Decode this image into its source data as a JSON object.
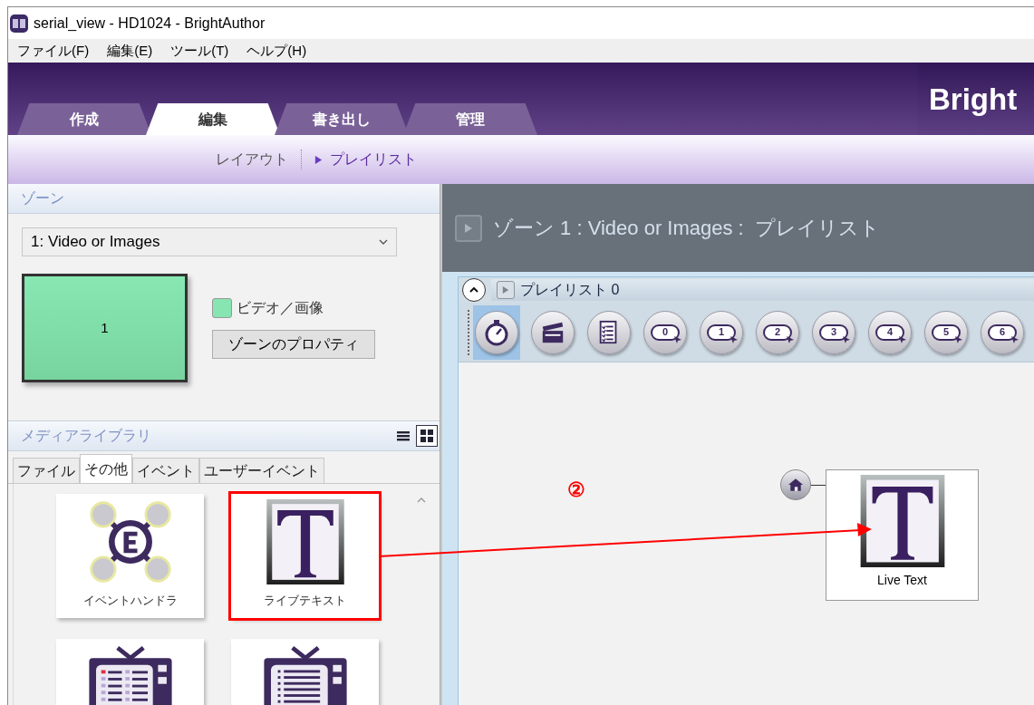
{
  "window": {
    "title": "serial_view - HD1024 - BrightAuthor"
  },
  "menu": [
    "ファイル(F)",
    "編集(E)",
    "ツール(T)",
    "ヘルプ(H)"
  ],
  "main_tabs": [
    {
      "label": "作成",
      "selected": false
    },
    {
      "label": "編集",
      "selected": true
    },
    {
      "label": "書き出し",
      "selected": false
    },
    {
      "label": "管理",
      "selected": false
    }
  ],
  "brand": "Bright",
  "sub_nav": [
    {
      "label": "レイアウト",
      "selected": false
    },
    {
      "label": "プレイリスト",
      "selected": true
    }
  ],
  "zone_panel": {
    "title": "ゾーン",
    "dropdown": "1: Video or Images",
    "preview_label": "1",
    "legend": {
      "label": "ビデオ／画像",
      "color": "#86e5b0"
    },
    "button": "ゾーンのプロパティ"
  },
  "media_library": {
    "title": "メディアライブラリ",
    "view_toggle": [
      {
        "kind": "list",
        "selected": false
      },
      {
        "kind": "grid",
        "selected": true
      }
    ],
    "tabs": [
      {
        "label": "ファイル",
        "selected": false
      },
      {
        "label": "その他",
        "selected": true
      },
      {
        "label": "イベント",
        "selected": false
      },
      {
        "label": "ユーザーイベント",
        "selected": false
      }
    ],
    "items": [
      {
        "kind": "event-handler",
        "label": "イベントハンドラ",
        "highlighted": false
      },
      {
        "kind": "live-text",
        "label": "ライブテキスト",
        "highlighted": true
      },
      {
        "kind": "tv-grid",
        "highlighted": false
      },
      {
        "kind": "tv-list",
        "highlighted": false
      }
    ]
  },
  "playlist_area": {
    "title": "ゾーン 1 : Video or Images :  プレイリスト",
    "playlist_name": "プレイリスト 0",
    "toolbar": [
      {
        "kind": "timer",
        "selected": true
      },
      {
        "kind": "clapper",
        "selected": false
      },
      {
        "kind": "checklist",
        "selected": false
      },
      {
        "kind": "number",
        "label": "0",
        "selected": false
      },
      {
        "kind": "number",
        "label": "1",
        "selected": false
      },
      {
        "kind": "number",
        "label": "2",
        "selected": false
      },
      {
        "kind": "number",
        "label": "3",
        "selected": false
      },
      {
        "kind": "number",
        "label": "4",
        "selected": false
      },
      {
        "kind": "number",
        "label": "5",
        "selected": false
      },
      {
        "kind": "number",
        "label": "6",
        "selected": false
      }
    ],
    "node": {
      "label": "Live Text",
      "initial": true
    }
  },
  "annotation": {
    "marker": "②"
  }
}
